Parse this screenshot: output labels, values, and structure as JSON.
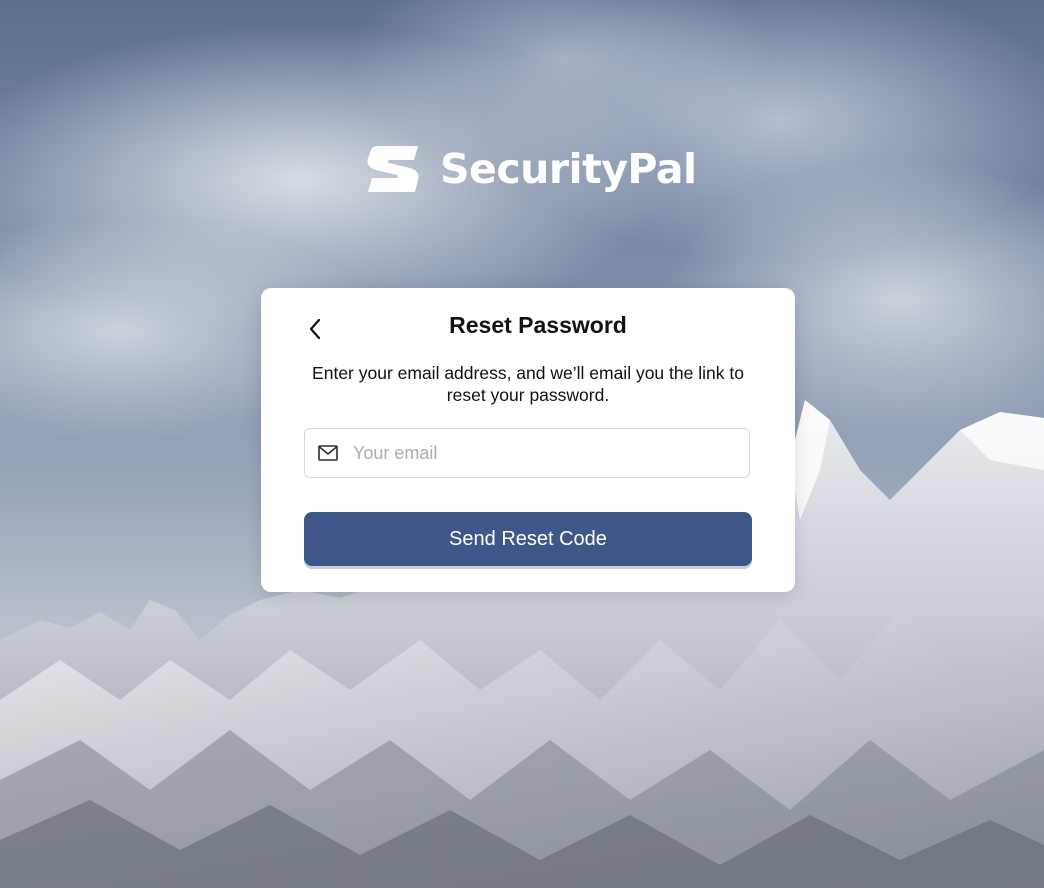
{
  "brand": {
    "name": "SecurityPal",
    "logo_icon": "securitypal-s-logo-icon"
  },
  "reset_card": {
    "back_icon": "chevron-left-icon",
    "title": "Reset Password",
    "description": "Enter your email address, and we’ll email you the link to reset your password.",
    "email_field": {
      "icon": "mail-icon",
      "placeholder": "Your email",
      "value": ""
    },
    "submit_label": "Send Reset Code"
  },
  "colors": {
    "primary_button": "#3f5788",
    "card_background": "#ffffff",
    "placeholder_text": "#a9adb4"
  }
}
